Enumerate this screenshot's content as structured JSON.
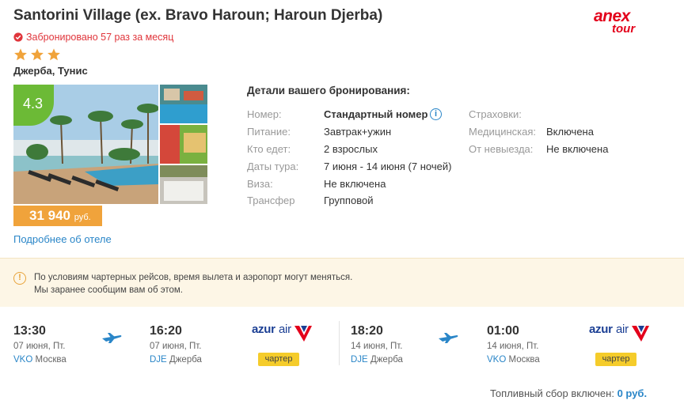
{
  "hotel": {
    "title": "Santorini Village (ex. Bravo Haroun; Haroun Djerba)",
    "booked_text": "Забронировано 57 раз за месяц",
    "stars": 3,
    "location": "Джерба, Тунис",
    "rating": "4.3",
    "price_value": "31 940",
    "price_currency": "руб.",
    "more_link": "Подробнее об отеле"
  },
  "operator_logo": {
    "line1": "anex",
    "line2": "tour",
    "color": "#e3001b"
  },
  "details": {
    "title": "Детали вашего бронирования:",
    "rows": [
      {
        "label": "Номер:",
        "value": "Стандартный номер"
      },
      {
        "label": "Питание:",
        "value": "Завтрак+ужин"
      },
      {
        "label": "Кто едет:",
        "value": "2 взрослых"
      },
      {
        "label": "Даты тура:",
        "value": "7 июня - 14 июня (7 ночей)"
      },
      {
        "label": "Виза:",
        "value": "Не включена"
      },
      {
        "label": "Трансфер",
        "value": "Групповой"
      }
    ],
    "insurance": [
      {
        "label": "Страховки:",
        "value": ""
      },
      {
        "label": "Медицинская:",
        "value": "Включена"
      },
      {
        "label": "От невыезда:",
        "value": "Не включена"
      }
    ]
  },
  "notice": {
    "line1": "По условиям чартерных рейсов, время вылета и аэропорт могут меняться.",
    "line2": "Мы заранее сообщим вам об этом."
  },
  "flights": [
    {
      "dep_time": "13:30",
      "dep_date": "07 июня, Пт.",
      "dep_code": "VKO",
      "dep_city": "Москва",
      "arr_time": "16:20",
      "arr_date": "07 июня, Пт.",
      "arr_code": "DJE",
      "arr_city": "Джерба",
      "airline_a": "azur",
      "airline_b": "air",
      "badge": "чартер"
    },
    {
      "dep_time": "18:20",
      "dep_date": "14 июня, Пт.",
      "dep_code": "DJE",
      "dep_city": "Джерба",
      "arr_time": "01:00",
      "arr_date": "14 июня, Пт.",
      "arr_code": "VKO",
      "arr_city": "Москва",
      "airline_a": "azur",
      "airline_b": "air",
      "badge": "чартер"
    }
  ],
  "fuel": {
    "label": "Топливный сбор включен:",
    "value": "0 руб."
  },
  "colors": {
    "link": "#2a86c8",
    "rating": "#6cba36",
    "price": "#f0a33b",
    "badge": "#f5cc2b"
  }
}
